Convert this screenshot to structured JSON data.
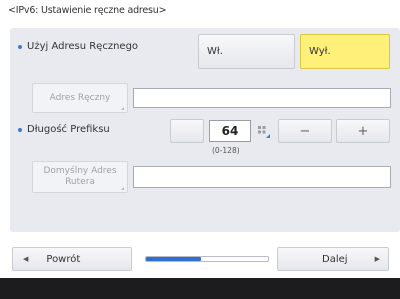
{
  "header": {
    "title": "<IPv6: Ustawienie ręczne adresu>"
  },
  "manual_address": {
    "label": "Użyj Adresu Ręcznego",
    "on_label": "Wł.",
    "off_label": "Wył.",
    "selected": "off"
  },
  "address": {
    "button_label": "Adres Ręczny",
    "value": ""
  },
  "prefix": {
    "label": "Długość Prefiksu",
    "value": "64",
    "range": "(0-128)",
    "minus_label": "−",
    "plus_label": "+"
  },
  "router": {
    "button_label": "Domyślny Adres Rutera",
    "value": ""
  },
  "footer": {
    "back_label": "Powrót",
    "next_label": "Dalej",
    "progress": 0.45
  },
  "colors": {
    "accent": "#2f6fd0",
    "selected": "#fff07a"
  }
}
